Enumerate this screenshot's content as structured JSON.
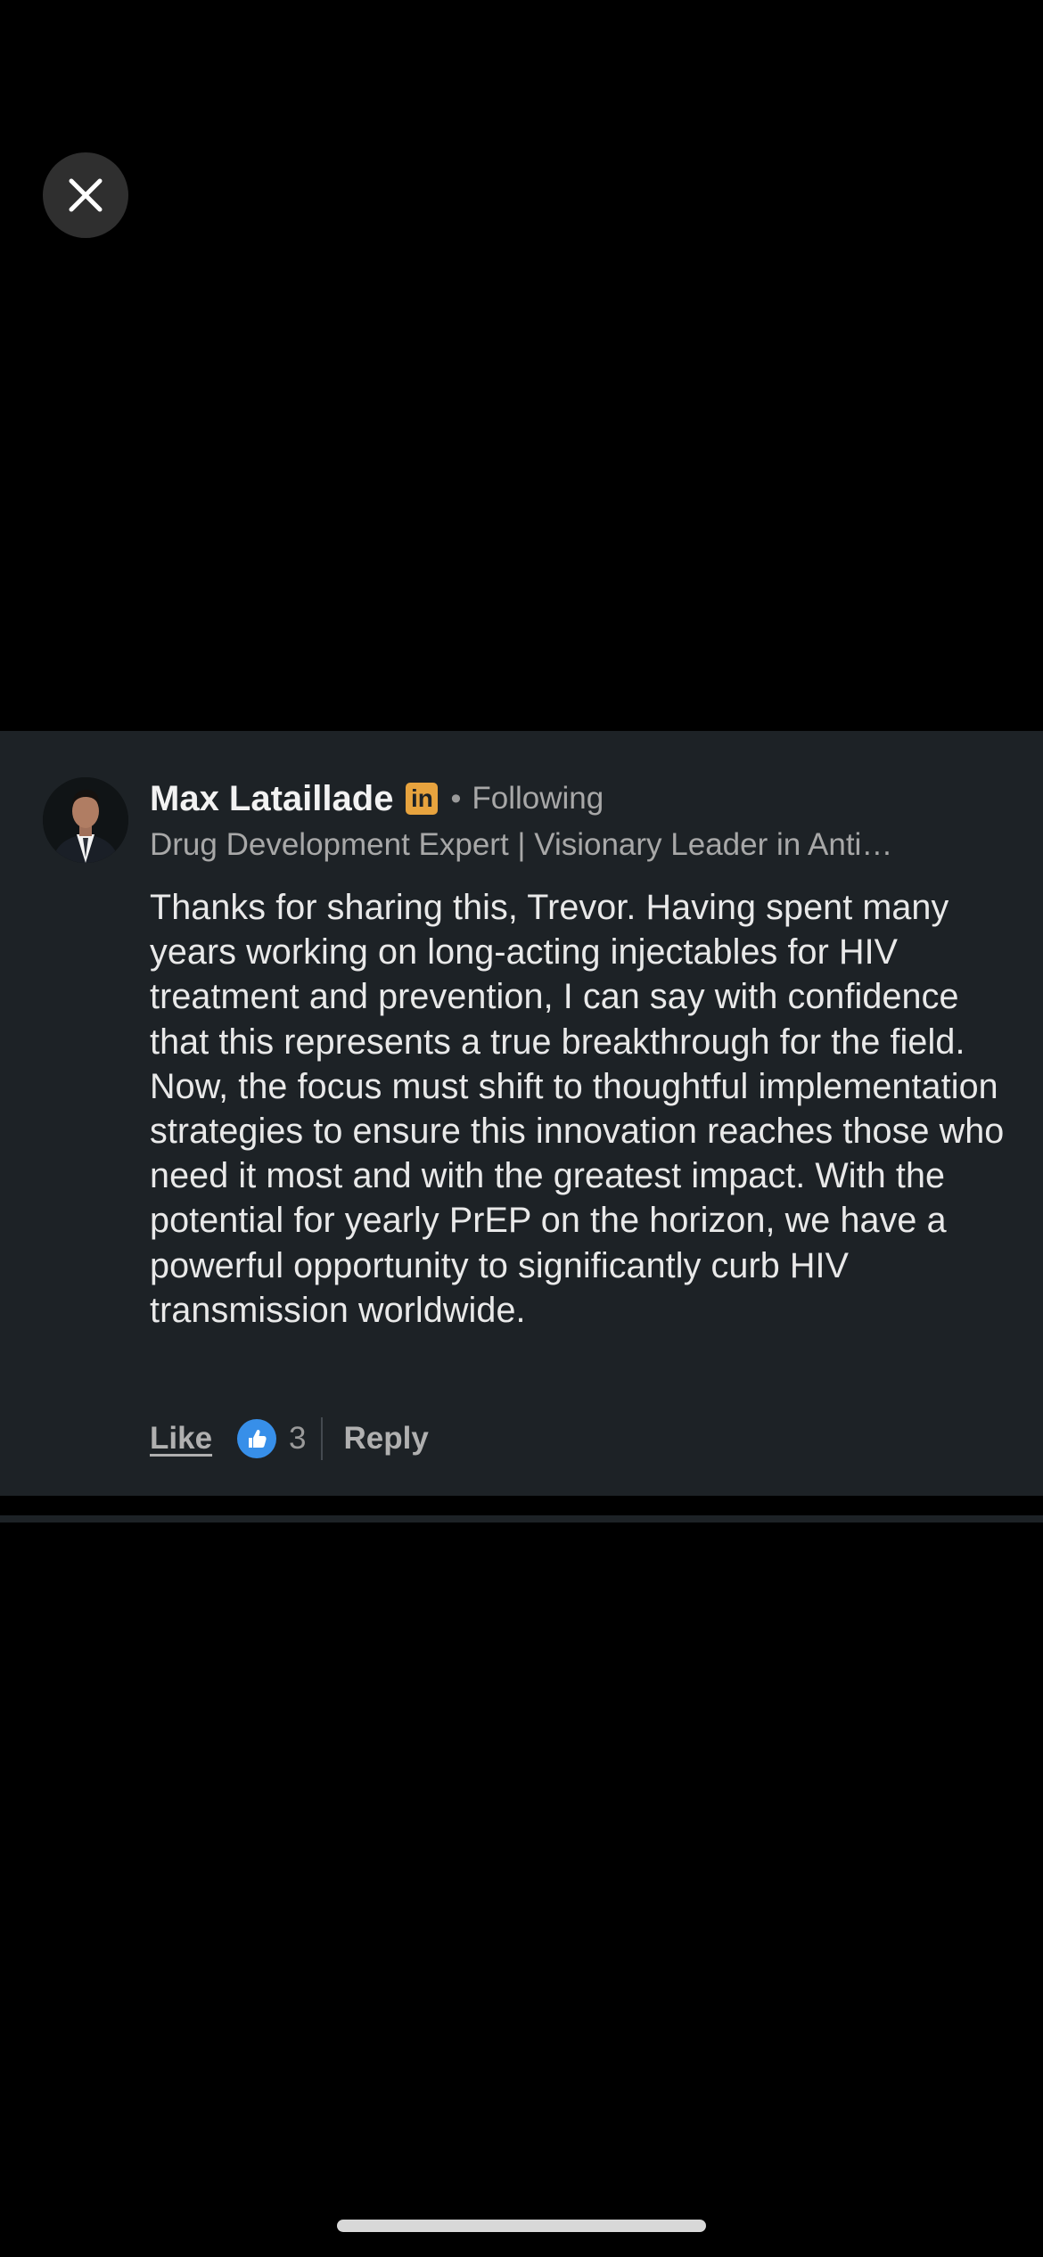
{
  "close": {
    "icon": "close-icon"
  },
  "comment": {
    "author_name": "Max Lataillade",
    "premium_badge": "in",
    "separator": "•",
    "connection_status": "Following",
    "headline": "Drug Development Expert | Visionary Leader in Anti…",
    "body": "Thanks for sharing this, Trevor. Having spent many years working on long-acting injectables for HIV treatment and prevention, I can say with confidence that this represents a true breakthrough for the field. Now, the focus must shift to thoughtful implementation strategies to ensure this innovation reaches those who need it most and with the greatest impact. With the potential for yearly PrEP on the horizon, we have a powerful opportunity to significantly curb HIV transmission worldwide.",
    "actions": {
      "like_label": "Like",
      "reaction_icon": "thumbs-up-icon",
      "reaction_count": "3",
      "reply_label": "Reply"
    }
  },
  "colors": {
    "background": "#000000",
    "card": "#1d2226",
    "badge": "#e7a33e",
    "like_reaction": "#378fe9"
  }
}
